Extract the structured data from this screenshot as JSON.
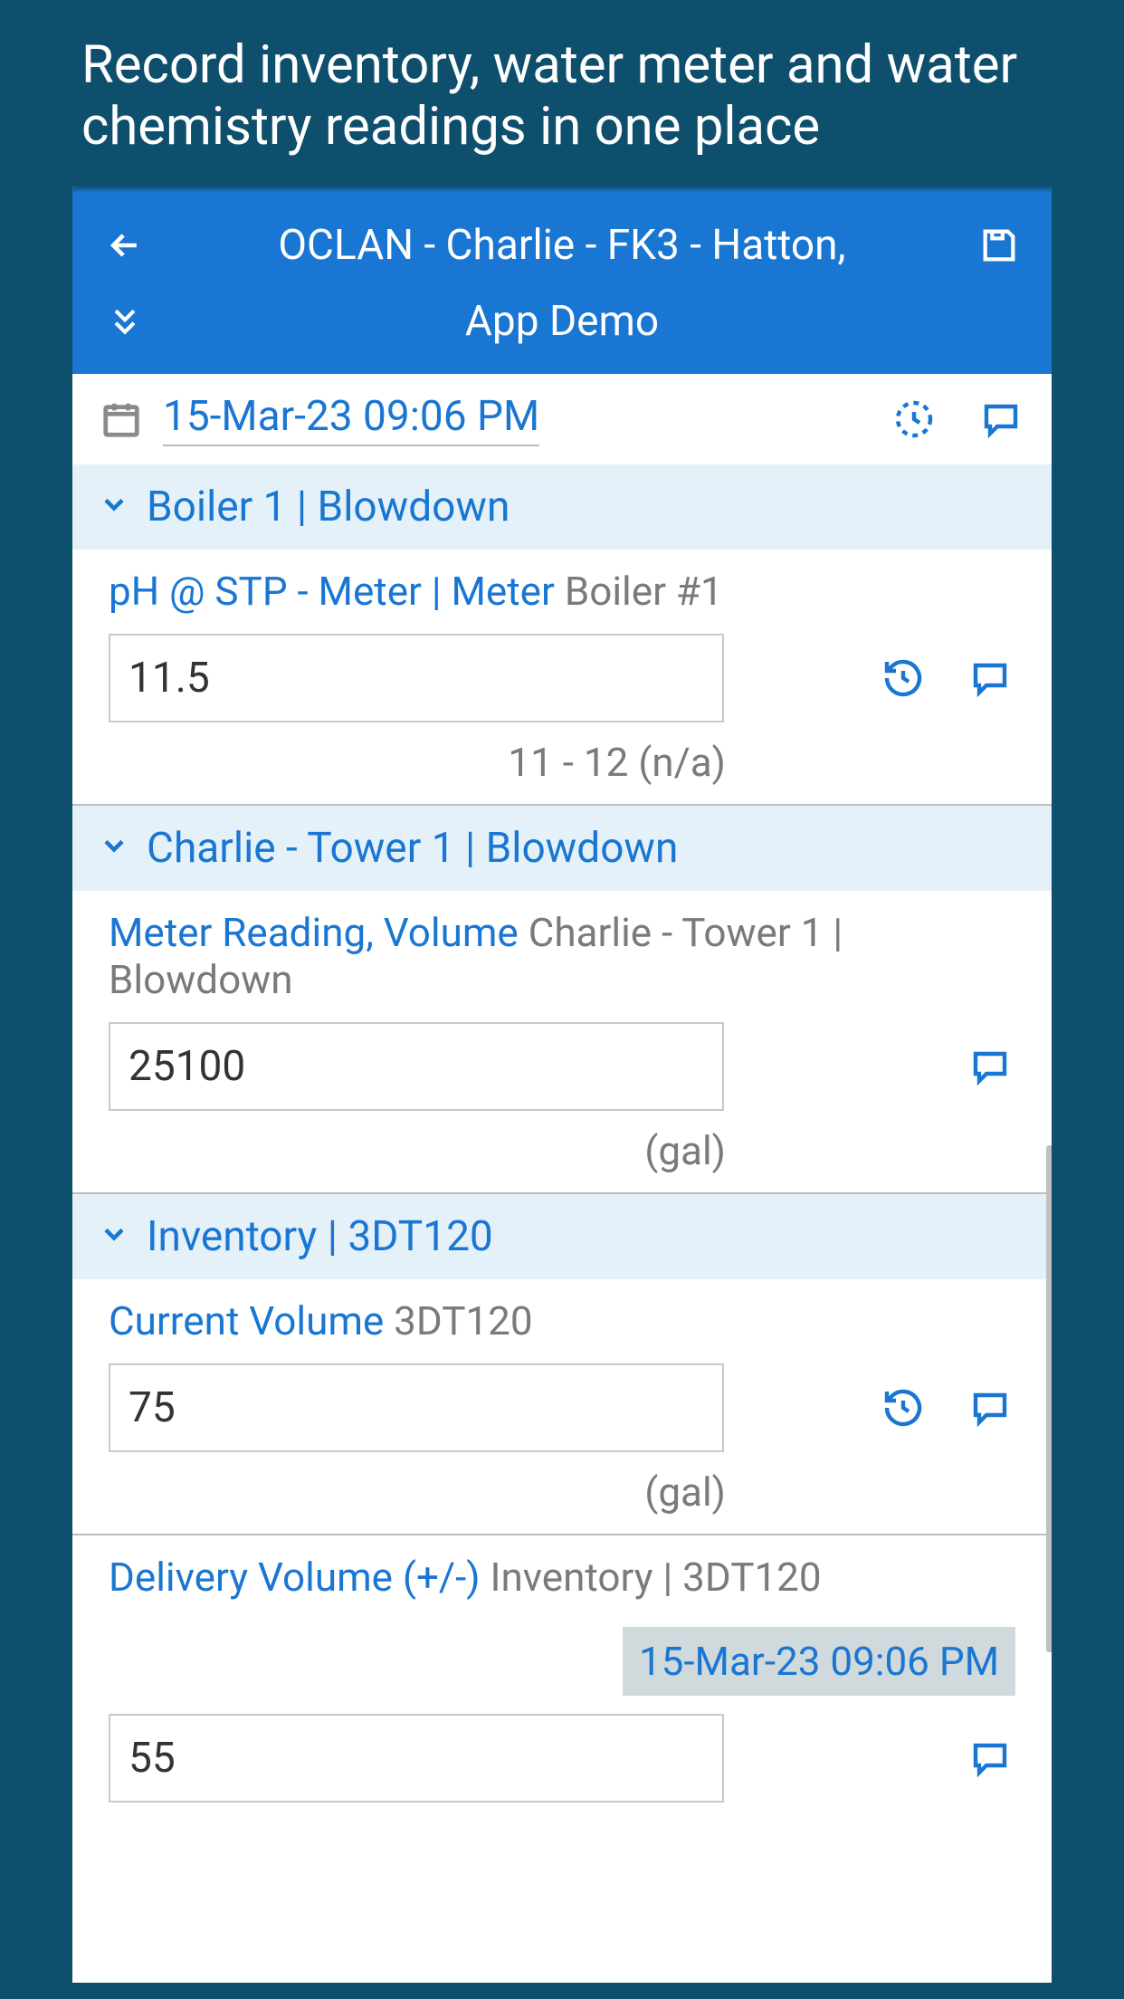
{
  "promo": "Record inventory, water meter and water chemistry readings in one place",
  "header": {
    "title": "OCLAN - Charlie - FK3 - Hatton,",
    "subtitle": "App Demo"
  },
  "date_row": {
    "date": "15-Mar-23 09:06 PM"
  },
  "sections": [
    {
      "title": "Boiler 1 | Blowdown",
      "fields": [
        {
          "label_main": "pH @ STP - Meter | Meter",
          "label_sub": "Boiler #1",
          "value": "11.5",
          "unit": "11 - 12 (n/a)",
          "has_history": true,
          "has_comment": true
        }
      ]
    },
    {
      "title": "Charlie - Tower 1 | Blowdown",
      "fields": [
        {
          "label_main": "Meter Reading, Volume",
          "label_sub": "Charlie - Tower 1 | Blowdown",
          "value": "25100",
          "unit": "(gal)",
          "has_history": false,
          "has_comment": true
        }
      ]
    },
    {
      "title": "Inventory | 3DT120",
      "fields": [
        {
          "label_main": "Current Volume",
          "label_sub": "3DT120",
          "value": "75",
          "unit": "(gal)",
          "has_history": true,
          "has_comment": true
        },
        {
          "label_main": "Delivery Volume (+/-)",
          "label_sub": "Inventory | 3DT120",
          "timestamp": "15-Mar-23 09:06 PM",
          "value": "55",
          "has_history": false,
          "has_comment": true
        }
      ]
    }
  ]
}
